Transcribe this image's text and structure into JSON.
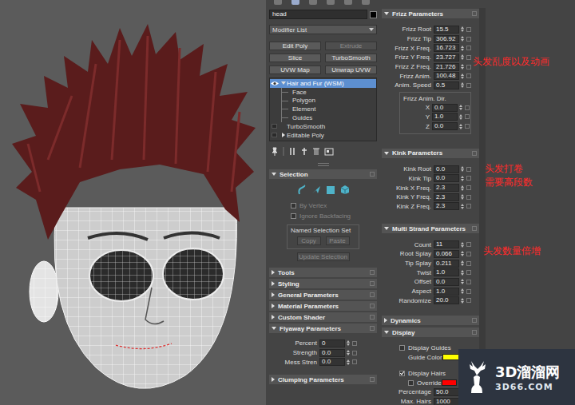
{
  "object": {
    "name": "head"
  },
  "modifier_list": {
    "label": "Modifier List"
  },
  "modifier_buttons": [
    {
      "label": "Edit Poly",
      "disabled": false
    },
    {
      "label": "Extrude",
      "disabled": true
    },
    {
      "label": "Slice",
      "disabled": false
    },
    {
      "label": "TurboSmooth",
      "disabled": false
    },
    {
      "label": "UVW Map",
      "disabled": false
    },
    {
      "label": "Unwrap UVW",
      "disabled": false
    }
  ],
  "stack": [
    {
      "label": "Hair and Fur (WSM)",
      "kind": "modifier",
      "selected": true,
      "has_children": true,
      "expanded": true
    },
    {
      "label": "Face",
      "kind": "sub-object",
      "selected": false,
      "has_children": false,
      "expanded": false
    },
    {
      "label": "Polygon",
      "kind": "sub-object",
      "selected": false,
      "has_children": false,
      "expanded": false
    },
    {
      "label": "Element",
      "kind": "sub-object",
      "selected": false,
      "has_children": false,
      "expanded": false
    },
    {
      "label": "Guides",
      "kind": "sub-object",
      "selected": false,
      "has_children": false,
      "expanded": false
    },
    {
      "label": "TurboSmooth",
      "kind": "modifier",
      "selected": false,
      "has_children": false,
      "expanded": false
    },
    {
      "label": "Editable Poly",
      "kind": "modifier",
      "selected": false,
      "has_children": true,
      "expanded": false
    }
  ],
  "selection": {
    "title": "Selection",
    "expanded": true,
    "by_vertex": {
      "label": "By Vertex",
      "checked": false,
      "disabled": true
    },
    "ignore_backfacing": {
      "label": "Ignore Backfacing",
      "checked": false,
      "disabled": true
    },
    "named_set": {
      "title": "Named Selection Set",
      "copy": {
        "label": "Copy",
        "disabled": true
      },
      "paste": {
        "label": "Paste",
        "disabled": true
      }
    },
    "update": {
      "label": "Update Selection",
      "disabled": true
    }
  },
  "left_rollouts": [
    {
      "title": "Tools",
      "expanded": false
    },
    {
      "title": "Styling",
      "expanded": false
    },
    {
      "title": "General Parameters",
      "expanded": false
    },
    {
      "title": "Material Parameters",
      "expanded": false
    },
    {
      "title": "Custom Shader",
      "expanded": false
    }
  ],
  "flyaway": {
    "title": "Flyaway Parameters",
    "expanded": true,
    "fields": [
      {
        "label": "Percent",
        "value": "0"
      },
      {
        "label": "Strength",
        "value": "0.0"
      },
      {
        "label": "Mess Stren",
        "value": "0.0"
      }
    ]
  },
  "clumping": {
    "title": "Clumping Parameters",
    "expanded": false
  },
  "frizz": {
    "title": "Frizz Parameters",
    "expanded": true,
    "fields": [
      {
        "label": "Frizz Root",
        "value": "15.5"
      },
      {
        "label": "Frizz Tip",
        "value": "306.92"
      },
      {
        "label": "Frizz X Freq.",
        "value": "16.723"
      },
      {
        "label": "Frizz Y Freq.",
        "value": "23.727"
      },
      {
        "label": "Frizz Z Freq.",
        "value": "21.726"
      },
      {
        "label": "Frizz Anim.",
        "value": "100.48"
      },
      {
        "label": "Anim. Speed",
        "value": "0.5"
      }
    ],
    "anim_dir": {
      "title": "Frizz Anim. Dir.",
      "fields": [
        {
          "label": "X",
          "value": "0.0"
        },
        {
          "label": "Y",
          "value": "1.0"
        },
        {
          "label": "Z",
          "value": "0.0"
        }
      ]
    }
  },
  "kink": {
    "title": "Kink Parameters",
    "expanded": true,
    "fields": [
      {
        "label": "Kink Root",
        "value": "0.0"
      },
      {
        "label": "Kink Tip",
        "value": "0.0"
      },
      {
        "label": "Kink X Freq.",
        "value": "2.3"
      },
      {
        "label": "Kink Y Freq.",
        "value": "2.3"
      },
      {
        "label": "Kink Z Freq.",
        "value": "2.3"
      }
    ]
  },
  "multi_strand": {
    "title": "Multi Strand Parameters",
    "expanded": true,
    "fields": [
      {
        "label": "Count",
        "value": "11"
      },
      {
        "label": "Root Splay",
        "value": "0.066"
      },
      {
        "label": "Tip Splay",
        "value": "0.211"
      },
      {
        "label": "Twist",
        "value": "1.0"
      },
      {
        "label": "Offset",
        "value": "0.0"
      },
      {
        "label": "Aspect",
        "value": "1.0"
      },
      {
        "label": "Randomize",
        "value": "20.0"
      }
    ]
  },
  "dynamics": {
    "title": "Dynamics",
    "expanded": false
  },
  "display": {
    "title": "Display",
    "expanded": true,
    "display_guides": {
      "label": "Display Guides",
      "checked": false
    },
    "guide_color": {
      "label": "Guide Color"
    },
    "display_hairs": {
      "label": "Display Hairs",
      "checked": true
    },
    "override": {
      "label": "Override",
      "checked": false
    },
    "fields": [
      {
        "label": "Percentage",
        "value": "50.0"
      },
      {
        "label": "Max. Hairs",
        "value": "1000"
      }
    ]
  },
  "annotations": [
    {
      "lines": [
        "头发乱度以及动画"
      ]
    },
    {
      "lines": [
        "头发打卷",
        "需要高段数"
      ]
    },
    {
      "lines": [
        "头发数量倍增"
      ]
    }
  ],
  "watermark": {
    "title": "3D溜溜网",
    "url": "3D66.COM"
  }
}
